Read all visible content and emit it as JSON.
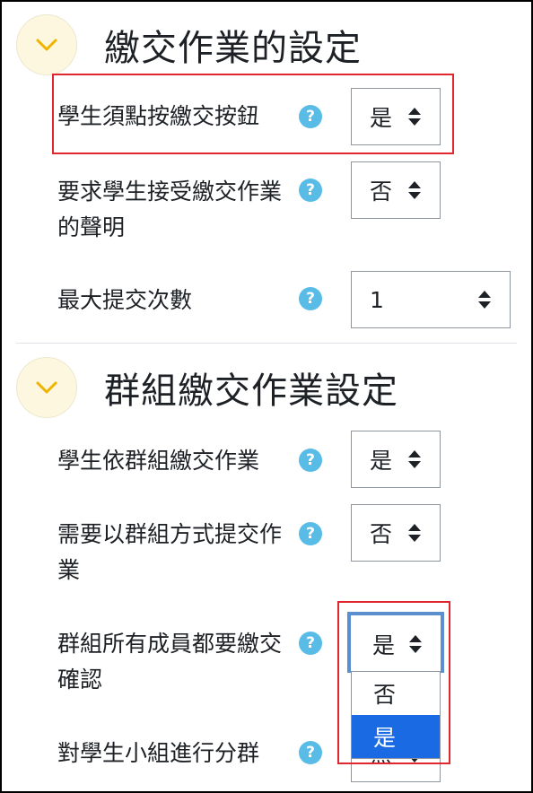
{
  "section1": {
    "title": "繳交作業的設定",
    "rows": [
      {
        "label": "學生須點按繳交按鈕",
        "value": "是"
      },
      {
        "label": "要求學生接受繳交作業的聲明",
        "value": "否"
      },
      {
        "label": "最大提交次數",
        "value": "1"
      }
    ]
  },
  "section2": {
    "title": "群組繳交作業設定",
    "rows": [
      {
        "label": "學生依群組繳交作業",
        "value": "是"
      },
      {
        "label": "需要以群組方式提交作業",
        "value": "否"
      },
      {
        "label": "群組所有成員都要繳交確認",
        "value": "是"
      },
      {
        "label": "對學生小組進行分群",
        "value": "無"
      }
    ],
    "dropdown_options": [
      "否",
      "是"
    ],
    "dropdown_selected": "是"
  },
  "help_glyph": "?",
  "colors": {
    "help": "#58bce7",
    "highlight": "#e0262e",
    "selected_option": "#1a6be3",
    "chevron": "#f0b400"
  }
}
